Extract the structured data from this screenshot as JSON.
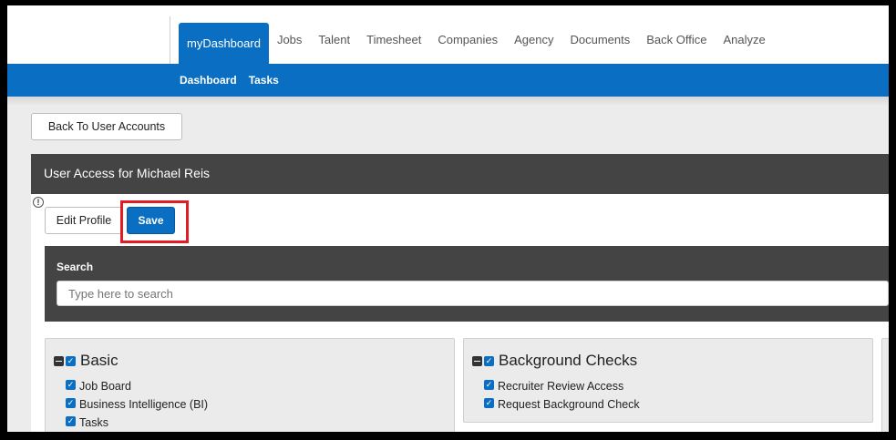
{
  "nav": {
    "items": [
      {
        "label": "myDashboard",
        "active": true
      },
      {
        "label": "Jobs"
      },
      {
        "label": "Talent"
      },
      {
        "label": "Timesheet"
      },
      {
        "label": "Companies"
      },
      {
        "label": "Agency"
      },
      {
        "label": "Documents"
      },
      {
        "label": "Back Office"
      },
      {
        "label": "Analyze"
      }
    ]
  },
  "subnav": {
    "items": [
      {
        "label": "Dashboard"
      },
      {
        "label": "Tasks"
      }
    ]
  },
  "back_button": "Back To User Accounts",
  "access": {
    "title": "User Access for Michael Reis",
    "info": "!",
    "edit_profile": "Edit Profile",
    "save": "Save"
  },
  "search": {
    "label": "Search",
    "placeholder": "Type here to search"
  },
  "permissions": {
    "basic": {
      "title": "Basic",
      "items": [
        "Job Board",
        "Business Intelligence (BI)",
        "Tasks"
      ]
    },
    "background_checks": {
      "title": "Background Checks",
      "items": [
        "Recruiter Review Access",
        "Request Background Check"
      ]
    }
  },
  "colors": {
    "primary": "#0a6fc2",
    "dark_panel": "#444444",
    "highlight": "#e31b23"
  }
}
